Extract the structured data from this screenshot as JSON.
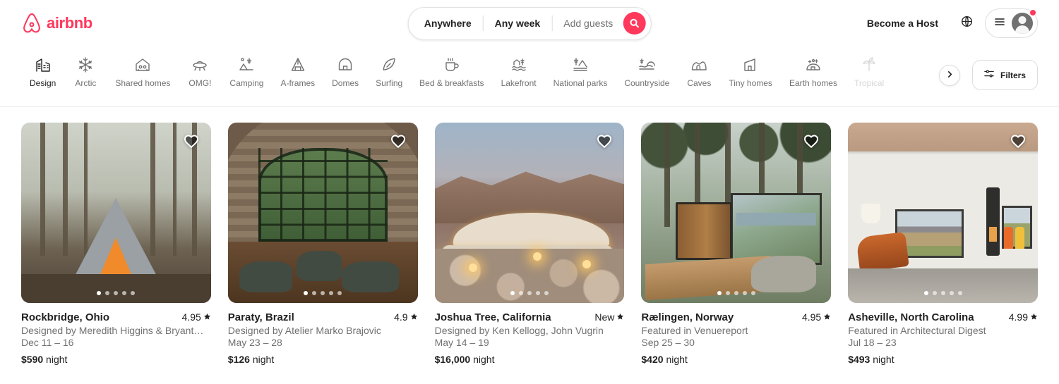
{
  "header": {
    "logo_text": "airbnb",
    "search": {
      "location_label": "Anywhere",
      "dates_label": "Any week",
      "guests_placeholder": "Add guests",
      "search_icon": "search-icon"
    },
    "become_host_label": "Become a Host",
    "globe_icon": "globe-icon",
    "menu_icon": "hamburger-menu-icon",
    "avatar_icon": "user-avatar-icon",
    "has_notification": true
  },
  "categories": {
    "items": [
      {
        "label": "Design",
        "icon": "design-building-icon",
        "active": true,
        "faded": false
      },
      {
        "label": "Arctic",
        "icon": "snowflake-icon",
        "active": false,
        "faded": false
      },
      {
        "label": "Shared homes",
        "icon": "shared-homes-icon",
        "active": false,
        "faded": false
      },
      {
        "label": "OMG!",
        "icon": "ufo-icon",
        "active": false,
        "faded": false
      },
      {
        "label": "Camping",
        "icon": "campsite-icon",
        "active": false,
        "faded": false
      },
      {
        "label": "A-frames",
        "icon": "a-frame-icon",
        "active": false,
        "faded": false
      },
      {
        "label": "Domes",
        "icon": "dome-icon",
        "active": false,
        "faded": false
      },
      {
        "label": "Surfing",
        "icon": "surfboard-icon",
        "active": false,
        "faded": false
      },
      {
        "label": "Bed & breakfasts",
        "icon": "coffee-cup-icon",
        "active": false,
        "faded": false
      },
      {
        "label": "Lakefront",
        "icon": "lakefront-icon",
        "active": false,
        "faded": false
      },
      {
        "label": "National parks",
        "icon": "national-park-icon",
        "active": false,
        "faded": false
      },
      {
        "label": "Countryside",
        "icon": "countryside-icon",
        "active": false,
        "faded": false
      },
      {
        "label": "Caves",
        "icon": "cave-icon",
        "active": false,
        "faded": false
      },
      {
        "label": "Tiny homes",
        "icon": "tiny-home-icon",
        "active": false,
        "faded": false
      },
      {
        "label": "Earth homes",
        "icon": "earth-home-icon",
        "active": false,
        "faded": false
      },
      {
        "label": "Tropical",
        "icon": "tropical-icon",
        "active": false,
        "faded": true
      }
    ],
    "next_icon": "chevron-right-icon",
    "filters_label": "Filters",
    "filters_icon": "filter-sliders-icon"
  },
  "listings": [
    {
      "title": "Rockbridge, Ohio",
      "rating": "4.95",
      "subtitle": "Designed by Meredith Higgins & Bryant…",
      "dates": "Dec 11 – 16",
      "price": "$590",
      "price_unit": "night",
      "photo_count": 5,
      "active_photo": 1,
      "favorited": false
    },
    {
      "title": "Paraty, Brazil",
      "rating": "4.9",
      "subtitle": "Designed by Atelier Marko Brajovic",
      "dates": "May 23 – 28",
      "price": "$126",
      "price_unit": "night",
      "photo_count": 5,
      "active_photo": 1,
      "favorited": false
    },
    {
      "title": "Joshua Tree, California",
      "rating": "New",
      "subtitle": "Designed by Ken Kellogg, John Vugrin",
      "dates": "May 14 – 19",
      "price": "$16,000",
      "price_unit": "night",
      "photo_count": 5,
      "active_photo": 1,
      "favorited": false
    },
    {
      "title": "Rælingen, Norway",
      "rating": "4.95",
      "subtitle": "Featured in Venuereport",
      "dates": "Sep 25 – 30",
      "price": "$420",
      "price_unit": "night",
      "photo_count": 5,
      "active_photo": 1,
      "favorited": false
    },
    {
      "title": "Asheville, North Carolina",
      "rating": "4.99",
      "subtitle": "Featured in Architectural Digest",
      "dates": "Jul 18 – 23",
      "price": "$493",
      "price_unit": "night",
      "photo_count": 5,
      "active_photo": 1,
      "favorited": false
    }
  ],
  "colors": {
    "brand": "#FF385C",
    "text_primary": "#222222",
    "text_secondary": "#717171",
    "border": "#dddddd"
  }
}
